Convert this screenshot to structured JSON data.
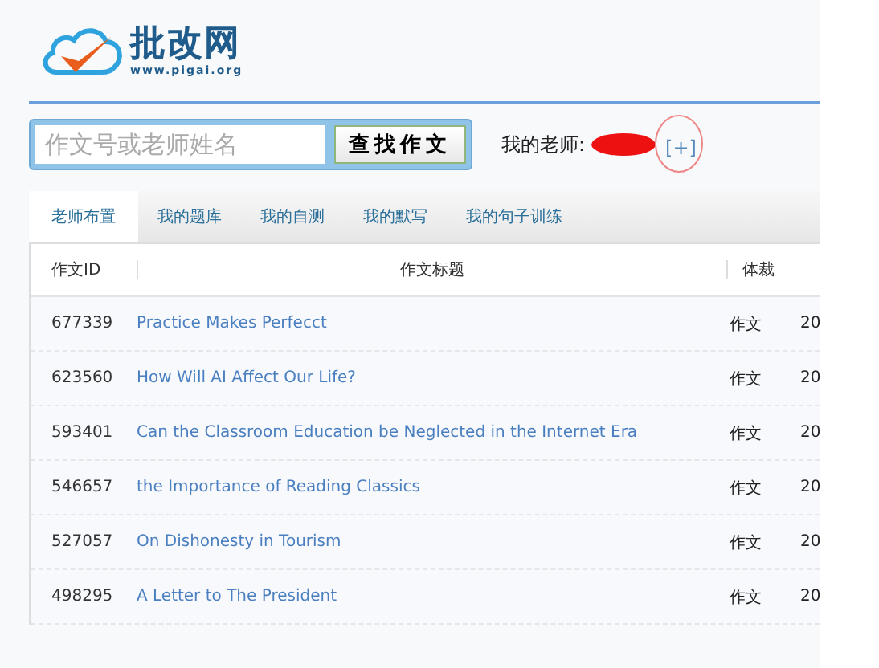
{
  "logo": {
    "name": "批改网",
    "url": "www.pigai.org"
  },
  "search": {
    "placeholder": "作文号或老师姓名",
    "button": "查找作文"
  },
  "teacher": {
    "label": "我的老师:",
    "add": "[+]"
  },
  "tabs": [
    {
      "label": "老师布置",
      "selected": true
    },
    {
      "label": "我的题库",
      "selected": false
    },
    {
      "label": "我的自测",
      "selected": false
    },
    {
      "label": "我的默写",
      "selected": false
    },
    {
      "label": "我的句子训练",
      "selected": false
    }
  ],
  "table": {
    "columns": [
      "作文ID",
      "作文标题",
      "体裁"
    ],
    "rows": [
      {
        "id": "677339",
        "title": "Practice Makes Perfecct",
        "genre": "作文",
        "column_4": "20"
      },
      {
        "id": "623560",
        "title": "How Will AI Affect Our Life?",
        "genre": "作文",
        "column_4": "20"
      },
      {
        "id": "593401",
        "title": "Can the Classroom Education be Neglected in the Internet Era",
        "genre": "作文",
        "column_4": "20"
      },
      {
        "id": "546657",
        "title": "the Importance of Reading Classics",
        "genre": "作文",
        "column_4": "20"
      },
      {
        "id": "527057",
        "title": "On Dishonesty in Tourism",
        "genre": "作文",
        "column_4": "20"
      },
      {
        "id": "498295",
        "title": "A Letter to The President",
        "genre": "作文",
        "column_4": "20"
      }
    ]
  }
}
